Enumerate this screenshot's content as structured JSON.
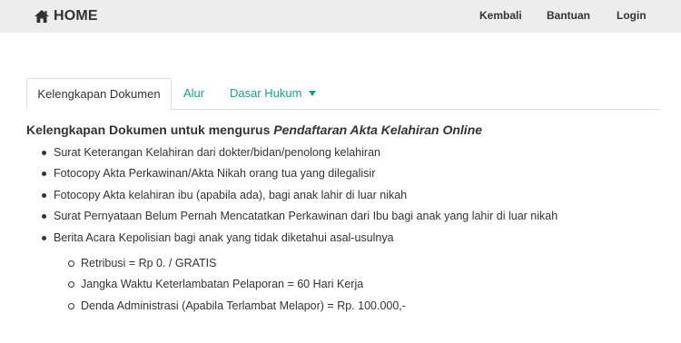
{
  "navbar": {
    "brand": "HOME",
    "brand_icon": "home-icon",
    "links": {
      "back": "Kembali",
      "help": "Bantuan",
      "login": "Login"
    }
  },
  "tabs": {
    "documents": "Kelengkapan Dokumen",
    "flow": "Alur",
    "legal": "Dasar Hukum"
  },
  "content": {
    "title_prefix": "Kelengkapan Dokumen untuk mengurus ",
    "title_emph": "Pendaftaran Akta Kelahiran Online",
    "items": [
      "Surat Keterangan Kelahiran dari dokter/bidan/penolong kelahiran",
      "Fotocopy Akta Perkawinan/Akta Nikah orang tua yang dilegalisir",
      "Fotocopy Akta kelahiran ibu (apabila ada), bagi anak lahir di luar nikah",
      "Surat Pernyataan Belum Pernah Mencatatkan Perkawinan dari Ibu bagi anak yang lahir di luar nikah",
      "Berita Acara Kepolisian bagi anak yang tidak diketahui asal-usulnya"
    ],
    "sub_items": [
      "Retribusi = Rp 0. / GRATIS",
      "Jangka Waktu Keterlambatan Pelaporan = 60 Hari Kerja",
      "Denda Administrasi (Apabila Terlambat Melapor) = Rp. 100.000,-"
    ]
  },
  "colors": {
    "navbar_bg": "#ecedec",
    "accent": "#18a085",
    "text": "#333333"
  }
}
